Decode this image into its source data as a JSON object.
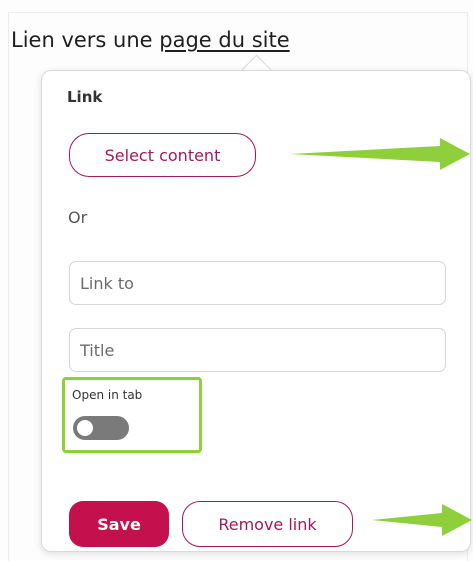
{
  "heading": {
    "prefix": "Lien vers une ",
    "link_text": "page du site"
  },
  "popover": {
    "title": "Link",
    "select_content_label": "Select content",
    "or_label": "Or",
    "link_to_placeholder": "Link to",
    "title_placeholder": "Title",
    "open_in_tab_label": "Open in tab",
    "open_in_tab_on": false,
    "save_label": "Save",
    "remove_link_label": "Remove link"
  },
  "colors": {
    "accent": "#a3195b",
    "save_bg": "#c5104e",
    "highlight": "#8fcf3c",
    "annotation_arrow": "#8fcf3c"
  },
  "icons": [
    "arrow-right-icon",
    "toggle-off-icon"
  ]
}
